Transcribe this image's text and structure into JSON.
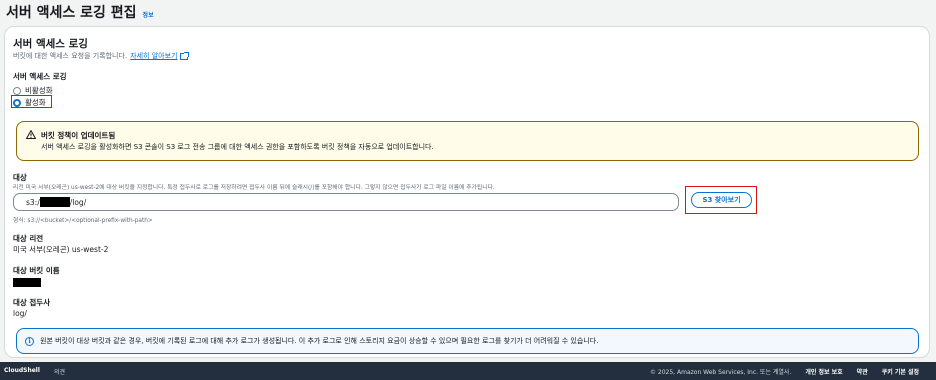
{
  "page": {
    "title": "서버 액세스 로깅 편집",
    "info_link": "정보"
  },
  "section": {
    "title": "서버 액세스 로깅",
    "description": "버킷에 대한 액세스 요청을 기록합니다.",
    "learn_more": "자세히 알아보기"
  },
  "logging": {
    "label": "서버 액세스 로깅",
    "options": [
      {
        "label": "비활성화",
        "selected": false
      },
      {
        "label": "활성화",
        "selected": true
      }
    ]
  },
  "warning": {
    "title": "버킷 정책이 업데이트됨",
    "text": "서버 액세스 로깅을 활성화하면 S3 콘솔이 S3 로그 전송 그룹에 대한 액세스 권한을 포함하도록 버킷 정책을 자동으로 업데이트합니다."
  },
  "target": {
    "label": "대상",
    "description": "리전 미국 서부(오레곤) us-west-2에 대상 버킷을 지정합니다. 특정 접두사로 로그를 저장하려면 접두사 이름 뒤에 슬래시(/)를 포함해야 합니다. 그렇지 않으면 접두사가 로그 파일 이름에 추가됩니다.",
    "value_prefix": "s3:/",
    "value_suffix": "/log/",
    "browse_button": "S3 찾아보기",
    "format_hint": "형식: s3://<bucket>/<optional-prefix-with-path>"
  },
  "target_region": {
    "label": "대상 리전",
    "value": "미국 서부(오레곤) us-west-2"
  },
  "target_bucket": {
    "label": "대상 버킷 이름"
  },
  "target_prefix": {
    "label": "대상 접두사",
    "value": "log/"
  },
  "info_alert": {
    "text": "원본 버킷이 대상 버킷과 같은 경우, 버킷에 기록된 로그에 대해 추가 로그가 생성됩니다. 이 추가 로그로 인해 스토리지 요금이 상승할 수 있으며 필요한 로그를 찾기가 더 어려워질 수 있습니다."
  },
  "footer": {
    "cloudshell": "CloudShell",
    "feedback": "의견",
    "copyright": "© 2025, Amazon Web Services, Inc. 또는 계열사.",
    "privacy": "개인 정보 보호",
    "terms": "약관",
    "cookies": "쿠키 기본 설정"
  },
  "colors": {
    "accent": "#0972d3",
    "highlight": "#d91515",
    "warning_border": "#8d6605",
    "footer_bg": "#232f3e"
  }
}
